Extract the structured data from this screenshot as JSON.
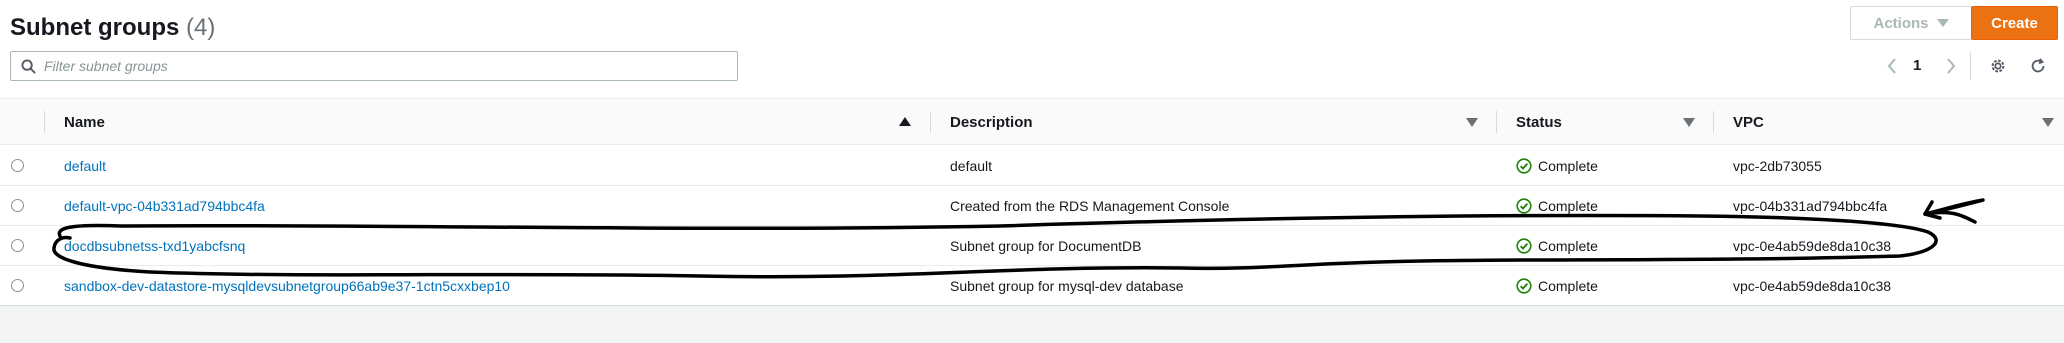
{
  "header": {
    "title": "Subnet groups",
    "count": "(4)",
    "actions_label": "Actions",
    "create_label": "Create"
  },
  "search": {
    "placeholder": "Filter subnet groups",
    "value": ""
  },
  "pagination": {
    "current_page": "1"
  },
  "table": {
    "columns": {
      "name": "Name",
      "description": "Description",
      "status": "Status",
      "vpc": "VPC"
    },
    "rows": [
      {
        "name": "default",
        "description": "default",
        "status": "Complete",
        "vpc": "vpc-2db73055"
      },
      {
        "name": "default-vpc-04b331ad794bbc4fa",
        "description": "Created from the RDS Management Console",
        "status": "Complete",
        "vpc": "vpc-04b331ad794bbc4fa"
      },
      {
        "name": "docdbsubnetss-txd1yabcfsnq",
        "description": "Subnet group for DocumentDB",
        "status": "Complete",
        "vpc": "vpc-0e4ab59de8da10c38"
      },
      {
        "name": "sandbox-dev-datastore-mysqldevsubnetgroup66ab9e37-1ctn5cxxbep10",
        "description": "Subnet group for mysql-dev database",
        "status": "Complete",
        "vpc": "vpc-0e4ab59de8da10c38"
      }
    ]
  },
  "colors": {
    "link": "#0073bb",
    "primary_button": "#ec7211",
    "status_success": "#1d8102",
    "annotation_ink": "#000000"
  },
  "icons": {
    "search": "search-icon",
    "prev": "chevron-left-icon",
    "next": "chevron-right-icon",
    "settings": "gear-icon",
    "refresh": "refresh-icon",
    "status": "check-circle-icon"
  }
}
